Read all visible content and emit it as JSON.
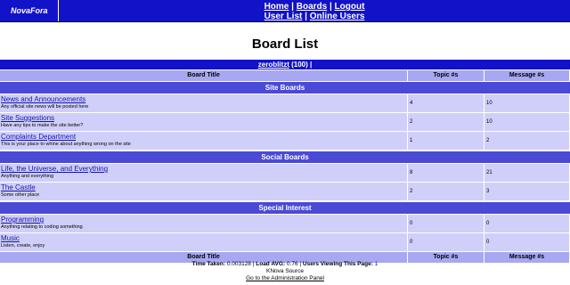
{
  "header": {
    "brand": "NovaFora",
    "nav_row1": [
      "Home",
      "Boards",
      "Logout"
    ],
    "nav_row2": [
      "User List",
      "Online Users"
    ]
  },
  "page_title": "Board List",
  "user_bar": {
    "username": "zeroblitzt",
    "count": "(100)"
  },
  "columns": {
    "title": "Board Title",
    "topics": "Topic #s",
    "messages": "Message #s"
  },
  "sections": [
    {
      "name": "Site Boards",
      "boards": [
        {
          "name": "News and Announcements",
          "desc": "Any official site news will be posted here",
          "topics": "4",
          "messages": "10"
        },
        {
          "name": "Site Suggestions",
          "desc": "Have any tips to make the site better?",
          "topics": "2",
          "messages": "10"
        },
        {
          "name": "Complaints Department",
          "desc": "This is your place to whine about anything wrong on the site",
          "topics": "1",
          "messages": "2"
        }
      ]
    },
    {
      "name": "Social Boards",
      "boards": [
        {
          "name": "Life, the Universe, and Everything",
          "desc": "Anything and everything",
          "topics": "8",
          "messages": "21"
        },
        {
          "name": "The Castle",
          "desc": "Some other place",
          "topics": "2",
          "messages": "3"
        }
      ]
    },
    {
      "name": "Special Interest",
      "boards": [
        {
          "name": "Programming",
          "desc": "Anything relating to coding something",
          "topics": "0",
          "messages": "0"
        },
        {
          "name": "Music",
          "desc": "Listen, create, enjoy",
          "topics": "0",
          "messages": "0"
        }
      ]
    }
  ],
  "footer": {
    "time_label": "Time Taken:",
    "time_value": "0.003128",
    "load_label": "Load AVG:",
    "load_value": "0.76",
    "viewers_label": "Users Viewing This Page:",
    "viewers_value": "1",
    "source": "KNova Source",
    "admin_link": "Go to the Administration Panel"
  },
  "colors": {
    "bar": "#1212c8",
    "section": "#4a4ad6",
    "header_row": "#a7a7f2",
    "board_row": "#cfcffa",
    "link": "#1515a8"
  }
}
